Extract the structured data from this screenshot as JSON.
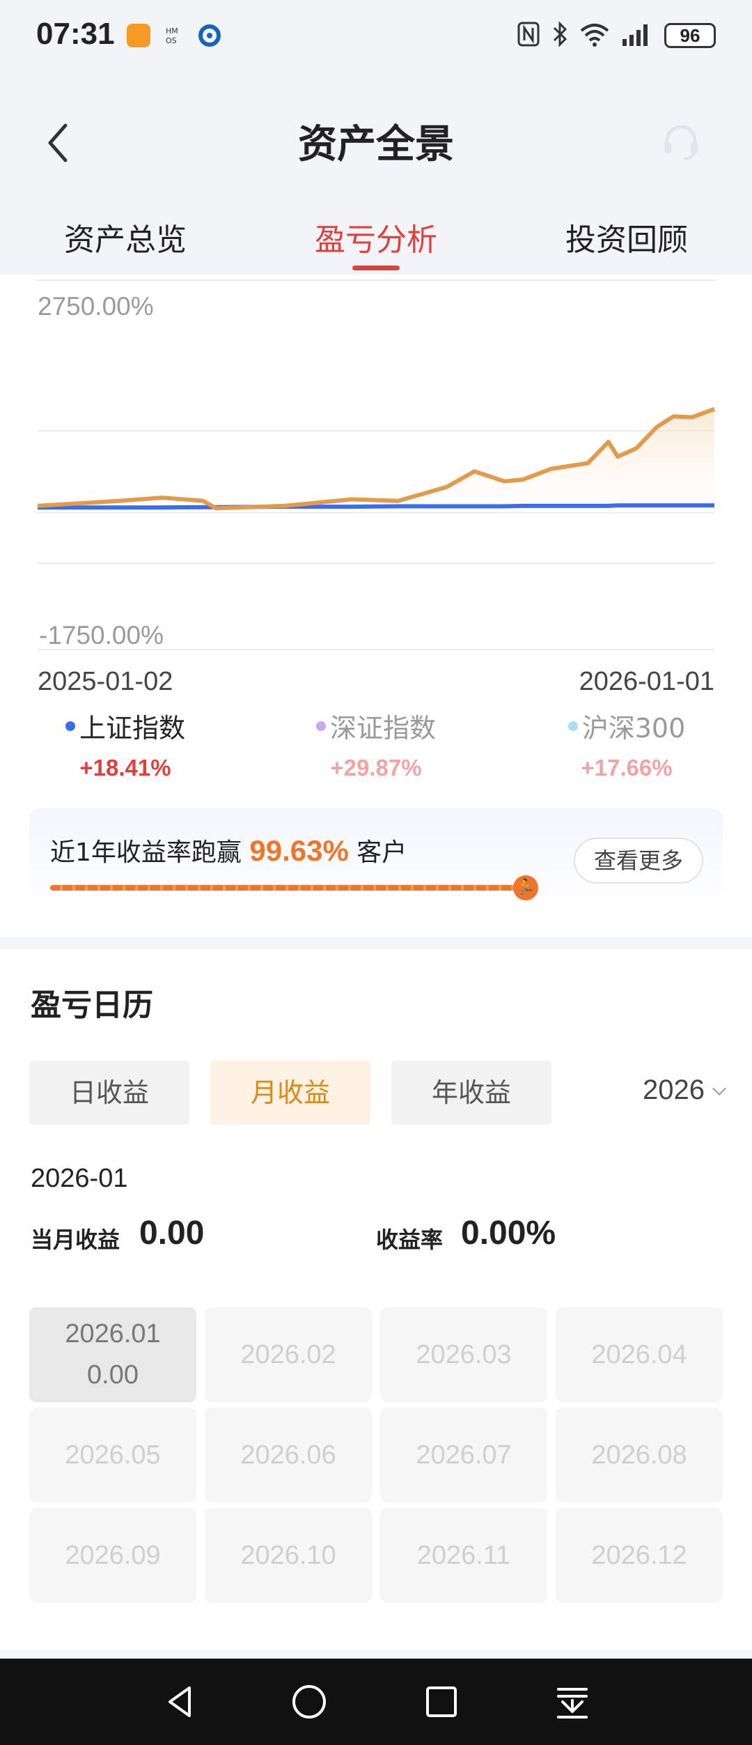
{
  "status": {
    "time": "07:31",
    "battery": "96",
    "colors": {
      "app_icon_1": "#f59a23",
      "app_icon_2": "#1565c0"
    }
  },
  "header": {
    "title": "资产全景",
    "tabs": [
      {
        "label": "资产总览",
        "active": false
      },
      {
        "label": "盈亏分析",
        "active": true
      },
      {
        "label": "投资回顾",
        "active": false
      }
    ],
    "icons": {
      "back": "back-arrow-icon",
      "service": "customer-service-icon"
    }
  },
  "chart": {
    "legend": [
      {
        "name": "上证指数",
        "value": "+18.41%",
        "color": "#3a6cf0",
        "name_color": "#222222",
        "value_color": "#e0403a"
      },
      {
        "name": "深证指数",
        "value": "+29.87%",
        "color": "#c9a6f0",
        "name_color": "#999999",
        "value_color": "#f2a3a3"
      },
      {
        "name": "沪深300",
        "value": "+17.66%",
        "color": "#a7e0f5",
        "name_color": "#999999",
        "value_color": "#f2a3a3"
      }
    ]
  },
  "chart_data": {
    "type": "line",
    "y_tick_labels": [
      "2750.00%",
      "-1750.00%"
    ],
    "x_tick_labels": [
      "2025-01-02",
      "2026-01-01"
    ],
    "ylim": [
      -1750,
      2750
    ],
    "x": [
      "2025-01-02",
      "2025-02-15",
      "2025-03-10",
      "2025-04-01",
      "2025-04-08",
      "2025-05-15",
      "2025-06-20",
      "2025-07-15",
      "2025-08-10",
      "2025-08-25",
      "2025-09-10",
      "2025-09-20",
      "2025-10-05",
      "2025-10-25",
      "2025-11-05",
      "2025-11-10",
      "2025-11-20",
      "2025-12-01",
      "2025-12-10",
      "2025-12-20",
      "2026-01-01"
    ],
    "series": [
      {
        "color": "#e39a4a",
        "values": [
          0,
          60,
          100,
          60,
          -30,
          0,
          80,
          60,
          230,
          420,
          300,
          320,
          450,
          520,
          780,
          600,
          700,
          960,
          1090,
          1080,
          1180
        ]
      },
      {
        "color": "#3a6cf0",
        "values": [
          -20,
          -20,
          -20,
          -15,
          -15,
          -10,
          -10,
          -5,
          -5,
          -5,
          -5,
          0,
          0,
          0,
          0,
          5,
          5,
          5,
          5,
          5,
          5
        ]
      }
    ],
    "grid": true
  },
  "ranking": {
    "prefix": "近1年收益率跑赢",
    "percent": "99.63%",
    "suffix": "客户",
    "fill_ratio": 0.9963,
    "more_label": "查看更多"
  },
  "calendar": {
    "title": "盈亏日历",
    "modes": [
      {
        "label": "日收益",
        "active": false
      },
      {
        "label": "月收益",
        "active": true
      },
      {
        "label": "年收益",
        "active": false
      }
    ],
    "year": "2026",
    "current_month": "2026-01",
    "month_profit_label": "当月收益",
    "month_profit_value": "0.00",
    "rate_label": "收益率",
    "rate_value": "0.00%",
    "months": [
      {
        "label": "2026.01",
        "value": "0.00",
        "active": true
      },
      {
        "label": "2026.02"
      },
      {
        "label": "2026.03"
      },
      {
        "label": "2026.04"
      },
      {
        "label": "2026.05"
      },
      {
        "label": "2026.06"
      },
      {
        "label": "2026.07"
      },
      {
        "label": "2026.08"
      },
      {
        "label": "2026.09"
      },
      {
        "label": "2026.10"
      },
      {
        "label": "2026.11"
      },
      {
        "label": "2026.12"
      }
    ]
  },
  "navbar": {
    "icons": [
      "back-triangle-icon",
      "home-circle-icon",
      "recents-square-icon",
      "notification-pulldown-icon"
    ]
  }
}
